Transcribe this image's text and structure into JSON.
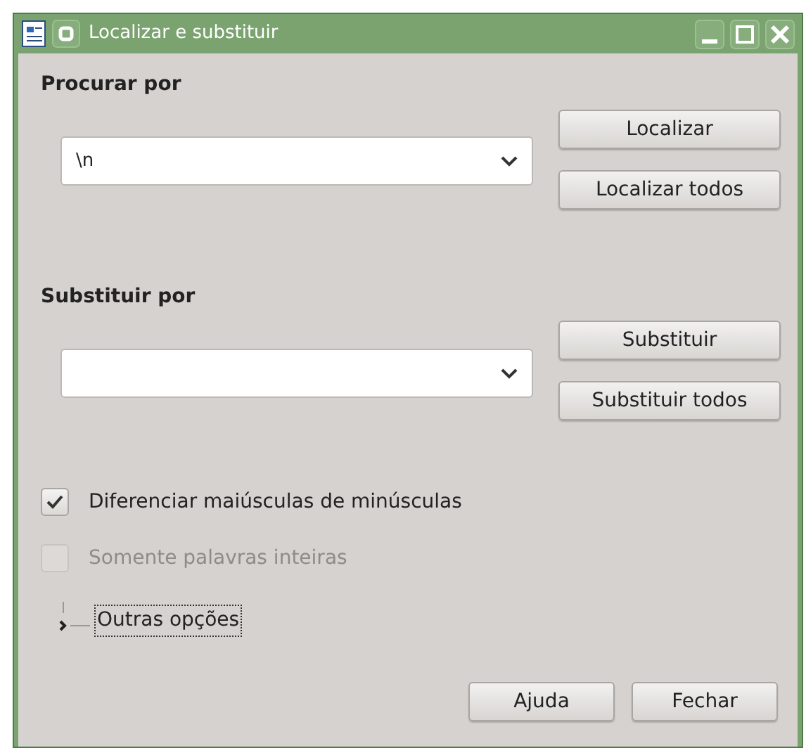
{
  "window": {
    "title": "Localizar e substituir"
  },
  "search": {
    "label": "Procurar por",
    "value": "\\n"
  },
  "search_buttons": [
    {
      "label": "Localizar"
    },
    {
      "label": "Localizar todos"
    }
  ],
  "replace": {
    "label": "Substituir por"
  },
  "replace_buttons": [
    {
      "label": "Substituir"
    },
    {
      "label": "Substituir todos"
    }
  ],
  "options": [
    {
      "label": "Diferenciar maiúsculas de minúsculas",
      "checked": true,
      "disabled": false
    },
    {
      "label": "Somente palavras inteiras",
      "checked": false,
      "disabled": true
    }
  ],
  "expander": {
    "label": "Outras opções",
    "expanded": false
  },
  "buttons": [
    {
      "label": "Ajuda"
    },
    {
      "label": "Fechar"
    }
  ]
}
